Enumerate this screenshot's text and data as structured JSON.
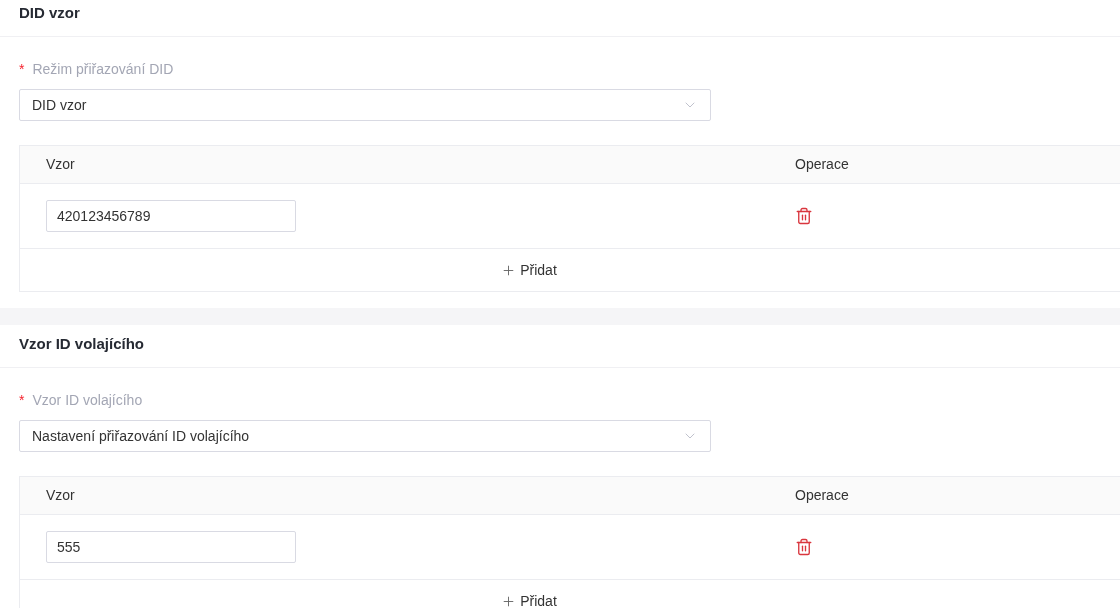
{
  "sections": [
    {
      "title": "DID vzor",
      "field": {
        "required_mark": "*",
        "label": "Režim přiřazování DID",
        "value": "DID vzor"
      },
      "table": {
        "columns": [
          "Vzor",
          "Operace"
        ],
        "rows": [
          {
            "pattern": "420123456789"
          }
        ],
        "add_label": "Přidat"
      }
    },
    {
      "title": "Vzor ID volajícího",
      "field": {
        "required_mark": "*",
        "label": "Vzor ID volajícího",
        "value": "Nastavení přiřazování ID volajícího"
      },
      "table": {
        "columns": [
          "Vzor",
          "Operace"
        ],
        "rows": [
          {
            "pattern": "555"
          }
        ],
        "add_label": "Přidat"
      }
    }
  ]
}
